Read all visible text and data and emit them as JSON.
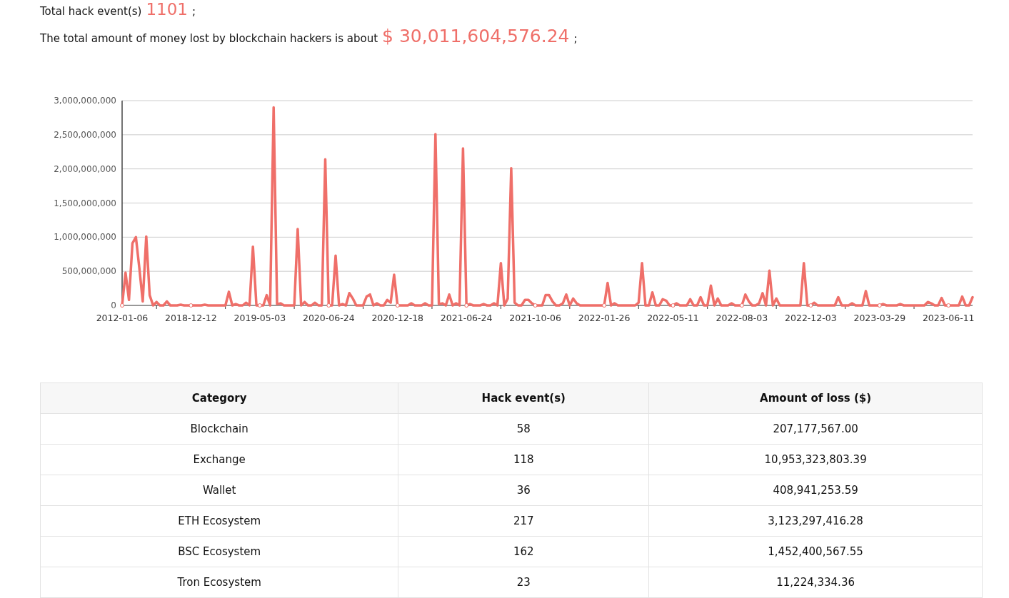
{
  "summary": [
    {
      "label": "Total hack event(s)",
      "value": "1101",
      "end": ";"
    },
    {
      "label": "The total amount of money lost by blockchain hackers is about",
      "value": "$ 30,011,604,576.24",
      "end": ";"
    }
  ],
  "chart": {
    "chart_data": {
      "type": "line",
      "grid": true,
      "ylim": [
        0,
        3000000000
      ],
      "yticks": [
        {
          "value": 0,
          "label": "0"
        },
        {
          "value": 500000000,
          "label": "500,000,000"
        },
        {
          "value": 1000000000,
          "label": "1,000,000,000"
        },
        {
          "value": 1500000000,
          "label": "1,500,000,000"
        },
        {
          "value": 2000000000,
          "label": "2,000,000,000"
        },
        {
          "value": 2500000000,
          "label": "2,500,000,000"
        },
        {
          "value": 3000000000,
          "label": "3,000,000,000"
        }
      ],
      "categories": [
        "2012-01-06",
        null,
        null,
        null,
        null,
        null,
        null,
        null,
        null,
        null,
        null,
        null,
        null,
        null,
        null,
        null,
        null,
        null,
        null,
        null,
        "2018-12-12",
        null,
        null,
        null,
        null,
        null,
        null,
        null,
        null,
        null,
        null,
        null,
        null,
        null,
        null,
        null,
        null,
        null,
        null,
        null,
        "2019-05-03",
        null,
        null,
        null,
        null,
        null,
        null,
        null,
        null,
        null,
        null,
        null,
        null,
        null,
        null,
        null,
        null,
        null,
        null,
        null,
        "2020-06-24",
        null,
        null,
        null,
        null,
        null,
        null,
        null,
        null,
        null,
        null,
        null,
        null,
        null,
        null,
        null,
        null,
        null,
        null,
        null,
        "2020-12-18",
        null,
        null,
        null,
        null,
        null,
        null,
        null,
        null,
        null,
        null,
        null,
        null,
        null,
        null,
        null,
        null,
        null,
        null,
        null,
        "2021-06-24",
        null,
        null,
        null,
        null,
        null,
        null,
        null,
        null,
        null,
        null,
        null,
        null,
        null,
        null,
        null,
        null,
        null,
        null,
        null,
        "2021-10-06",
        null,
        null,
        null,
        null,
        null,
        null,
        null,
        null,
        null,
        null,
        null,
        null,
        null,
        null,
        null,
        null,
        null,
        null,
        null,
        "2022-01-26",
        null,
        null,
        null,
        null,
        null,
        null,
        null,
        null,
        null,
        null,
        null,
        null,
        null,
        null,
        null,
        null,
        null,
        null,
        null,
        "2022-05-11",
        null,
        null,
        null,
        null,
        null,
        null,
        null,
        null,
        null,
        null,
        null,
        null,
        null,
        null,
        null,
        null,
        null,
        null,
        null,
        "2022-08-03",
        null,
        null,
        null,
        null,
        null,
        null,
        null,
        null,
        null,
        null,
        null,
        null,
        null,
        null,
        null,
        null,
        null,
        null,
        null,
        "2022-12-03",
        null,
        null,
        null,
        null,
        null,
        null,
        null,
        null,
        null,
        null,
        null,
        null,
        null,
        null,
        null,
        null,
        null,
        null,
        null,
        "2023-03-29",
        null,
        null,
        null,
        null,
        null,
        null,
        null,
        null,
        null,
        null,
        null,
        null,
        null,
        null,
        null,
        null,
        null,
        null,
        null,
        "2023-06-11",
        null,
        null,
        null,
        null,
        null,
        null,
        null
      ],
      "series": [
        {
          "color": "#ef6f69",
          "values": [
            0,
            480000000,
            80000000,
            910000000,
            1000000000,
            550000000,
            60000000,
            1010000000,
            150000000,
            0,
            50000000,
            0,
            0,
            60000000,
            0,
            0,
            0,
            10000000,
            0,
            0,
            0,
            0,
            0,
            0,
            10000000,
            0,
            0,
            0,
            0,
            0,
            0,
            200000000,
            0,
            20000000,
            0,
            0,
            40000000,
            0,
            860000000,
            0,
            0,
            0,
            150000000,
            0,
            2900000000,
            20000000,
            30000000,
            0,
            0,
            0,
            0,
            1120000000,
            0,
            50000000,
            0,
            0,
            40000000,
            0,
            0,
            2140000000,
            0,
            0,
            730000000,
            0,
            20000000,
            0,
            180000000,
            100000000,
            0,
            0,
            0,
            130000000,
            160000000,
            0,
            30000000,
            0,
            0,
            80000000,
            40000000,
            450000000,
            0,
            0,
            0,
            0,
            30000000,
            0,
            0,
            0,
            30000000,
            0,
            0,
            2510000000,
            20000000,
            30000000,
            0,
            160000000,
            0,
            30000000,
            0,
            2300000000,
            0,
            20000000,
            0,
            0,
            0,
            20000000,
            0,
            0,
            30000000,
            0,
            620000000,
            0,
            100000000,
            2010000000,
            40000000,
            0,
            0,
            80000000,
            80000000,
            30000000,
            0,
            0,
            0,
            150000000,
            150000000,
            60000000,
            0,
            0,
            30000000,
            160000000,
            0,
            100000000,
            30000000,
            0,
            0,
            0,
            0,
            0,
            0,
            0,
            0,
            330000000,
            0,
            30000000,
            0,
            0,
            0,
            0,
            0,
            0,
            40000000,
            620000000,
            0,
            0,
            190000000,
            0,
            0,
            90000000,
            70000000,
            0,
            0,
            30000000,
            0,
            0,
            0,
            90000000,
            0,
            0,
            120000000,
            0,
            0,
            290000000,
            0,
            100000000,
            0,
            0,
            0,
            30000000,
            0,
            0,
            0,
            160000000,
            60000000,
            0,
            0,
            30000000,
            180000000,
            0,
            510000000,
            0,
            100000000,
            0,
            0,
            0,
            0,
            0,
            0,
            0,
            620000000,
            0,
            0,
            40000000,
            0,
            0,
            0,
            0,
            0,
            0,
            120000000,
            0,
            0,
            0,
            30000000,
            0,
            0,
            0,
            210000000,
            0,
            0,
            0,
            0,
            20000000,
            0,
            0,
            0,
            0,
            20000000,
            0,
            0,
            0,
            0,
            0,
            0,
            0,
            50000000,
            30000000,
            0,
            0,
            110000000,
            0,
            0,
            0,
            0,
            0,
            130000000,
            0,
            0,
            120000000
          ]
        }
      ]
    }
  },
  "table": {
    "columns": [
      "Category",
      "Hack event(s)",
      "Amount of loss ($)"
    ],
    "rows": [
      [
        "Blockchain",
        "58",
        "207,177,567.00"
      ],
      [
        "Exchange",
        "118",
        "10,953,323,803.39"
      ],
      [
        "Wallet",
        "36",
        "408,941,253.59"
      ],
      [
        "ETH Ecosystem",
        "217",
        "3,123,297,416.28"
      ],
      [
        "BSC Ecosystem",
        "162",
        "1,452,400,567.55"
      ],
      [
        "Tron Ecosystem",
        "23",
        "11,224,334.36"
      ]
    ]
  }
}
